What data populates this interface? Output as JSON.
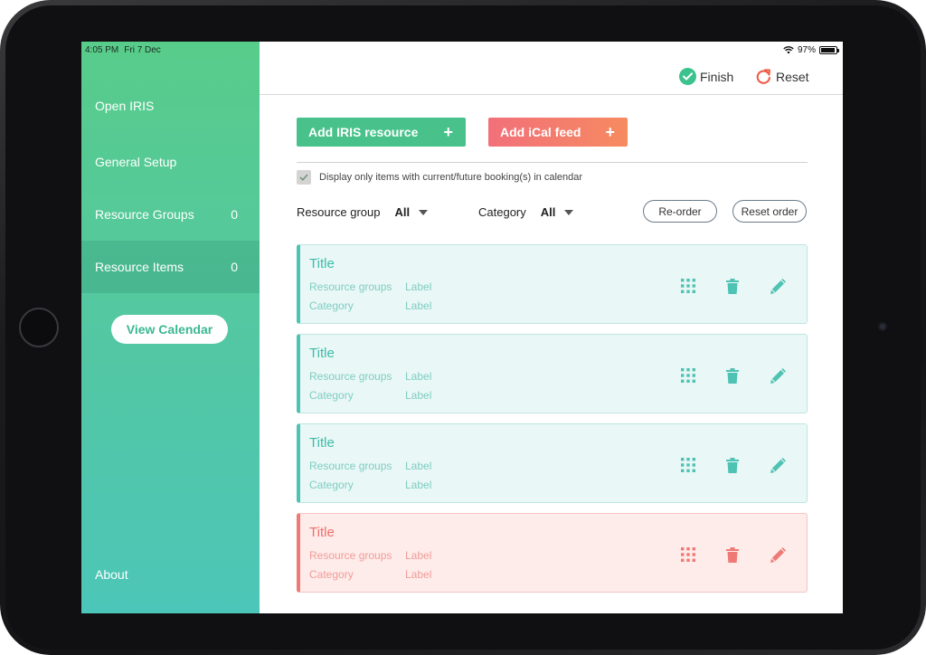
{
  "status_bar": {
    "time": "4:05 PM",
    "date": "Fri 7 Dec",
    "battery": "97%"
  },
  "sidebar": {
    "items": [
      {
        "label": "Open IRIS",
        "count": ""
      },
      {
        "label": "General Setup",
        "count": ""
      },
      {
        "label": "Resource Groups",
        "count": "0"
      },
      {
        "label": "Resource Items",
        "count": "0"
      }
    ],
    "view_calendar": "View Calendar",
    "about": "About"
  },
  "toolbar": {
    "finish_label": "Finish",
    "reset_label": "Reset"
  },
  "actions": {
    "add_iris": "Add IRIS resource",
    "add_ical": "Add iCal feed",
    "plus": "+"
  },
  "filter_checkbox": {
    "label": "Display only items with current/future booking(s) in calendar",
    "checked": true
  },
  "filters": {
    "resource_group": {
      "label": "Resource group",
      "value": "All"
    },
    "category": {
      "label": "Category",
      "value": "All"
    }
  },
  "buttons": {
    "reorder": "Re-order",
    "reset_order": "Reset order"
  },
  "colors": {
    "sidebar_top": "#58cc8a",
    "sidebar_bottom": "#4cc6b8",
    "teal": "#4ec2b3",
    "red": "#ef7a75",
    "green_button": "#48c28a"
  },
  "cards": [
    {
      "title": "Title",
      "group_key": "Resource groups",
      "group_val": "Label",
      "cat_key": "Category",
      "cat_val": "Label",
      "variant": "teal"
    },
    {
      "title": "Title",
      "group_key": "Resource groups",
      "group_val": "Label",
      "cat_key": "Category",
      "cat_val": "Label",
      "variant": "teal"
    },
    {
      "title": "Title",
      "group_key": "Resource groups",
      "group_val": "Label",
      "cat_key": "Category",
      "cat_val": "Label",
      "variant": "teal"
    },
    {
      "title": "Title",
      "group_key": "Resource groups",
      "group_val": "Label",
      "cat_key": "Category",
      "cat_val": "Label",
      "variant": "red"
    }
  ],
  "icons": {
    "drag": "grid-icon",
    "delete": "trash-icon",
    "edit": "pencil-icon",
    "finish": "check-circle-icon",
    "reset": "refresh-icon"
  }
}
